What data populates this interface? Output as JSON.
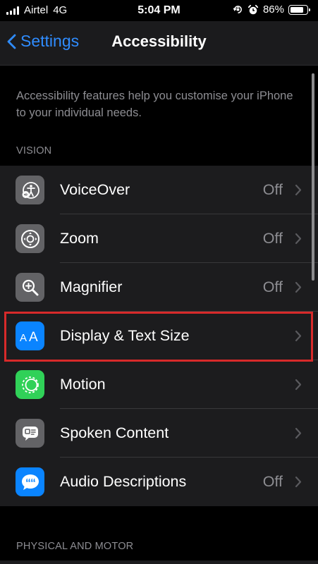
{
  "status_bar": {
    "carrier": "Airtel",
    "network": "4G",
    "time": "5:04 PM",
    "battery_percent": "86%",
    "battery_level": 0.86
  },
  "nav": {
    "back_label": "Settings",
    "title": "Accessibility"
  },
  "description": "Accessibility features help you customise your iPhone to your individual needs.",
  "sections": {
    "vision": "VISION",
    "physical": "PHYSICAL AND MOTOR"
  },
  "rows": [
    {
      "label": "VoiceOver",
      "value": "Off",
      "icon": "voiceover-icon",
      "icon_color": "#636366"
    },
    {
      "label": "Zoom",
      "value": "Off",
      "icon": "zoom-icon",
      "icon_color": "#636366"
    },
    {
      "label": "Magnifier",
      "value": "Off",
      "icon": "magnifier-icon",
      "icon_color": "#636366"
    },
    {
      "label": "Display & Text Size",
      "value": "",
      "icon": "text-size-icon",
      "icon_color": "#0a84ff"
    },
    {
      "label": "Motion",
      "value": "",
      "icon": "motion-icon",
      "icon_color": "#30d158"
    },
    {
      "label": "Spoken Content",
      "value": "",
      "icon": "spoken-content-icon",
      "icon_color": "#636366"
    },
    {
      "label": "Audio Descriptions",
      "value": "Off",
      "icon": "audio-descriptions-icon",
      "icon_color": "#0a84ff"
    }
  ],
  "colors": {
    "accent": "#2f8cff",
    "highlight": "#d72a2a",
    "background": "#000000",
    "cell": "#1c1c1e"
  }
}
